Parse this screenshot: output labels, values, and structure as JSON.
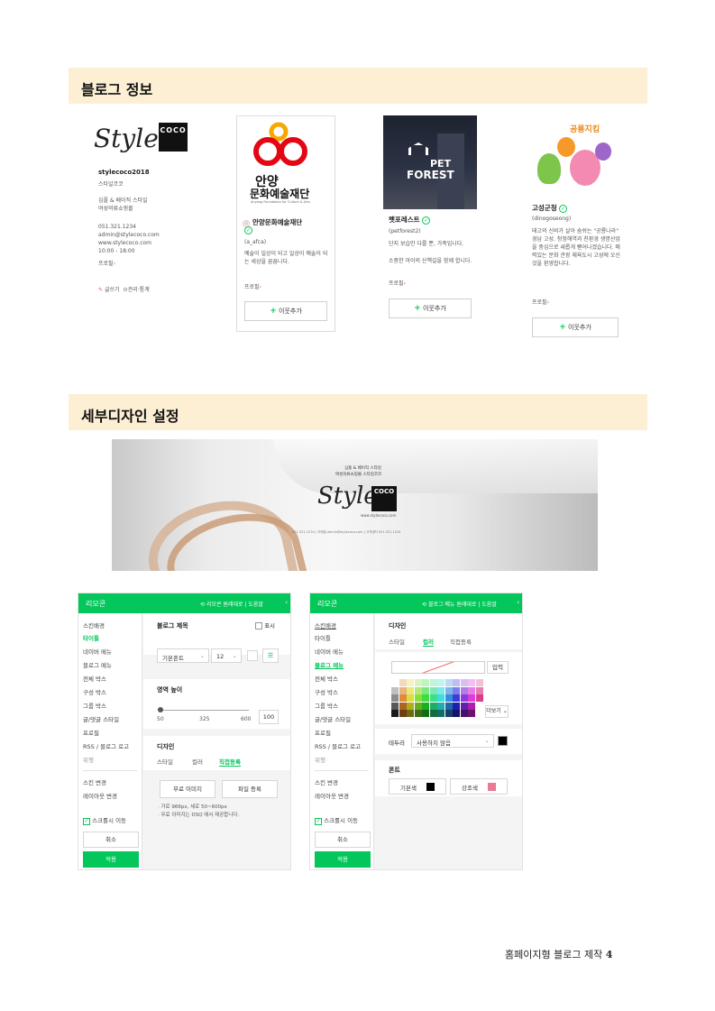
{
  "section1": {
    "title": "블로그 정보"
  },
  "style_blog": {
    "logo_word": "Style",
    "logo_mark": "COCO",
    "id": "stylecoco2018",
    "name": "스타일코코",
    "desc1": "심플 & 베이직 스타일",
    "desc2": "여성의류쇼핑몰",
    "phone": "051.321.1234",
    "email": "admin@stylecoco.com",
    "url": "www.stylecoco.com",
    "hours": "10:00 - 18:00",
    "profile": "프로필",
    "write": "글쓰기",
    "manage": "관리·통계"
  },
  "anyang": {
    "logo_kr1": "안양",
    "logo_kr2": "문화예술재단",
    "logo_en": "Anyang Foundation for Culture & Arts",
    "name": "안양문화예술재단",
    "id": "(a_afca)",
    "desc": "예술이 일상이 되고 일상이 예술이 되는 세상을 꿈꿉니다.",
    "profile": "프로필",
    "add": "이웃추가"
  },
  "petforest": {
    "logo_line1": "PET",
    "logo_line2": "FOREST",
    "name": "펫포레스트",
    "id": "(petforest2)",
    "desc1": "단지 보습만 다를 뿐, 가족입니다.",
    "desc2": "소중한 아이의 산책길을 함께 합니다.",
    "profile": "프로필",
    "add": "이웃추가"
  },
  "goseong": {
    "badge": "공룡지킴",
    "name": "고성군청",
    "id": "(dinogoseong)",
    "desc": "태고의 신비가 살아 숨쉬는 \"공룡나라\" 경남 고성. 청정해역과 친환경 생명산업을 중심으로 새롭게 뻗어나겠습니다. 매력있는 문화 관광 체육도시 고성에 오신것을 환영합니다.",
    "profile": "프로필",
    "add": "이웃추가"
  },
  "section2": {
    "title": "세부디자인 설정"
  },
  "banner": {
    "tag1": "심플 & 베이직 스타일",
    "tag2": "여성의류쇼핑몰 스타일코코",
    "logo_word": "Style",
    "logo_mark": "COCO",
    "url": "www.stylecoco.com",
    "footer": "051-321-1234  |  이메일 admin@stylecoco.com  |  고객센터 051.321.1234"
  },
  "panel_left": {
    "title": "리모콘",
    "head_link1": "리모콘 원래대로",
    "head_link2": "도움말",
    "menu": [
      "스킨배경",
      "타이틀",
      "네이버 메뉴",
      "블로그 메뉴",
      "전체 박스",
      "구성 박스",
      "그룹 박스",
      "글/댓글 스타일",
      "프로필",
      "RSS / 블로그 로고",
      "위젯"
    ],
    "skin_change": "스킨 변경",
    "layout_change": "레이아웃 변경",
    "scroll": "스크롤시 이동",
    "cancel": "취소",
    "apply": "적용",
    "blog_title_label": "블로그 제목",
    "show": "표시",
    "font": "기본폰트",
    "size": "12",
    "area_height": "영역 높이",
    "slider_min": "50",
    "slider_mid": "325",
    "slider_max": "600",
    "slider_value": "100",
    "design": "디자인",
    "tab_style": "스타일",
    "tab_color": "컬러",
    "tab_direct": "직접등록",
    "free_image": "무료 이미지",
    "file_register": "파일 등록",
    "note1": "· 가로 966px, 세로 50~600px",
    "note2": "· 무료 이미지는 DSQ 에서 제공합니다."
  },
  "panel_right": {
    "title": "리모콘",
    "head_link1": "블로그 메뉴 원래대로",
    "head_link2": "도움말",
    "menu": [
      "스킨배경",
      "타이틀",
      "네이버 메뉴",
      "블로그 메뉴",
      "전체 박스",
      "구성 박스",
      "그룹 박스",
      "글/댓글 스타일",
      "프로필",
      "RSS / 블로그 로고",
      "위젯"
    ],
    "skin_change": "스킨 변경",
    "layout_change": "레이아웃 변경",
    "scroll": "스크롤시 이동",
    "cancel": "취소",
    "apply": "적용",
    "design": "디자인",
    "tab_style": "스타일",
    "tab_color": "컬러",
    "tab_direct": "직접등록",
    "input_btn": "입력",
    "more": "더보기",
    "border": "테두리",
    "border_value": "사용하지 않음",
    "font_label": "폰트",
    "basic_color": "기본색",
    "accent_color": "강조색",
    "basic_swatch": "#000000",
    "accent_swatch": "#e87a93"
  },
  "footer": {
    "text": "홈페이지형 블로그 제작",
    "page": "4"
  },
  "colors": {
    "brand_green": "#03c75a",
    "header_bg": "#fcefd4"
  }
}
